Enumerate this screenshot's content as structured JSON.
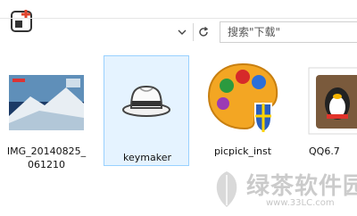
{
  "search": {
    "placeholder": "搜索\"下载\""
  },
  "icons": {
    "app": "app-window-add-icon",
    "dropdown": "chevron-down-icon",
    "refresh": "refresh-icon",
    "keymaker": "hat-icon",
    "picpick": "paint-palette-icon",
    "qq": "qq-icon"
  },
  "files": [
    {
      "name": "IMG_20140825_061210",
      "name_line1": "IMG_20140825_",
      "name_line2": "061210",
      "type": "image"
    },
    {
      "name": "keymaker",
      "type": "application",
      "selected": true
    },
    {
      "name": "picpick_inst",
      "type": "application"
    },
    {
      "name": "QQ6.7",
      "type": "application"
    }
  ],
  "watermark": {
    "text": "绿茶软件园",
    "url": "www.33LC.com"
  },
  "colors": {
    "selection_bg": "#e5f3ff",
    "selection_border": "#99d1ff",
    "accent": "#e0442c"
  }
}
